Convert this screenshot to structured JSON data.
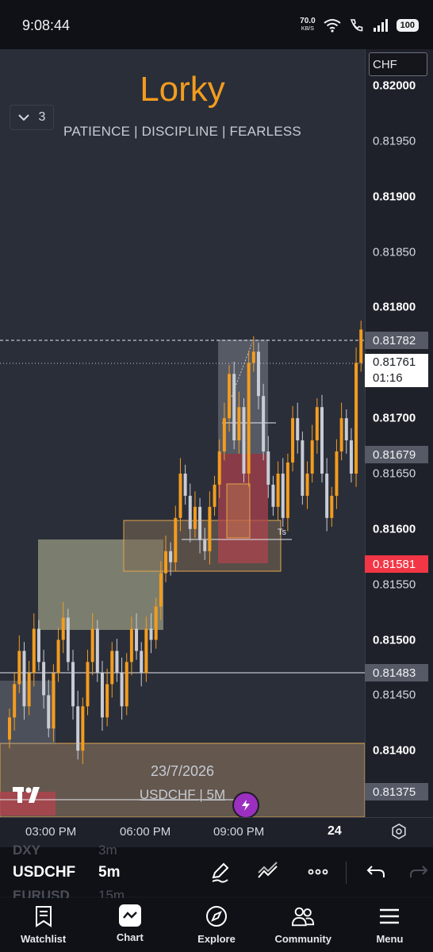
{
  "status_bar": {
    "time": "9:08:44",
    "net_speed": "70.0",
    "net_unit": "KB/S",
    "battery": "100"
  },
  "chart": {
    "indicator_count": "3",
    "watermark_title": "Lorky",
    "watermark_subtitle": "PATIENCE  |  DISCIPLINE  |  FEARLESS",
    "currency": "CHF",
    "date_stamp": "23/7/2026",
    "symbol_stamp": "USDCHF | 5M",
    "ts_label": "Ts"
  },
  "price_axis": {
    "labels": [
      {
        "text": "0.82000",
        "bold": true
      },
      {
        "text": "0.81950",
        "bold": false
      },
      {
        "text": "0.81900",
        "bold": true
      },
      {
        "text": "0.81850",
        "bold": false
      },
      {
        "text": "0.81800",
        "bold": true
      },
      {
        "text": "0.81700",
        "bold": true
      },
      {
        "text": "0.81650",
        "bold": false
      },
      {
        "text": "0.81600",
        "bold": true
      },
      {
        "text": "0.81550",
        "bold": false
      },
      {
        "text": "0.81500",
        "bold": true
      },
      {
        "text": "0.81450",
        "bold": false
      },
      {
        "text": "0.81400",
        "bold": true
      }
    ],
    "tags": {
      "t1": "0.81782",
      "t2": "0.81679",
      "t3": "0.81581",
      "t4": "0.81483",
      "t5": "0.81375"
    },
    "current_price": "0.81761",
    "countdown": "01:16"
  },
  "time_axis": {
    "t1": "03:00 PM",
    "t2": "06:00 PM",
    "t3": "09:00 PM",
    "day": "24"
  },
  "chart_data": {
    "type": "candlestick",
    "symbol": "USDCHF",
    "interval": "5m",
    "ylim": [
      0.8134,
      0.82033
    ],
    "current": 0.81761,
    "close": [
      0.8143,
      0.8146,
      0.8149,
      0.8144,
      0.8147,
      0.8151,
      0.8148,
      0.8145,
      0.8142,
      0.8147,
      0.815,
      0.8152,
      0.8148,
      0.8144,
      0.814,
      0.8144,
      0.8148,
      0.8151,
      0.8147,
      0.8143,
      0.8146,
      0.8149,
      0.8147,
      0.8144,
      0.8148,
      0.8151,
      0.8149,
      0.8147,
      0.8151,
      0.815,
      0.8153,
      0.8156,
      0.8158,
      0.8157,
      0.8161,
      0.8165,
      0.8163,
      0.816,
      0.8162,
      0.8159,
      0.8158,
      0.8162,
      0.8164,
      0.8167,
      0.817,
      0.8174,
      0.8168,
      0.8171,
      0.8165,
      0.8175,
      0.8176,
      0.8172,
      0.8167,
      0.8164,
      0.8162,
      0.8165,
      0.8161,
      0.8166,
      0.817,
      0.8168,
      0.8163,
      0.8165,
      0.8168,
      0.8171,
      0.8165,
      0.8161,
      0.8163,
      0.8167,
      0.817,
      0.8168,
      0.8165,
      0.8175,
      0.8178
    ]
  },
  "toolbar": {
    "ghost_symbol_top": "DXY",
    "ghost_interval_top": "3m",
    "symbol": "USDCHF",
    "interval": "5m",
    "ghost_symbol_bottom": "EURUSD",
    "ghost_interval_bottom": "15m"
  },
  "nav": {
    "watchlist": "Watchlist",
    "chart": "Chart",
    "explore": "Explore",
    "community": "Community",
    "menu": "Menu"
  }
}
